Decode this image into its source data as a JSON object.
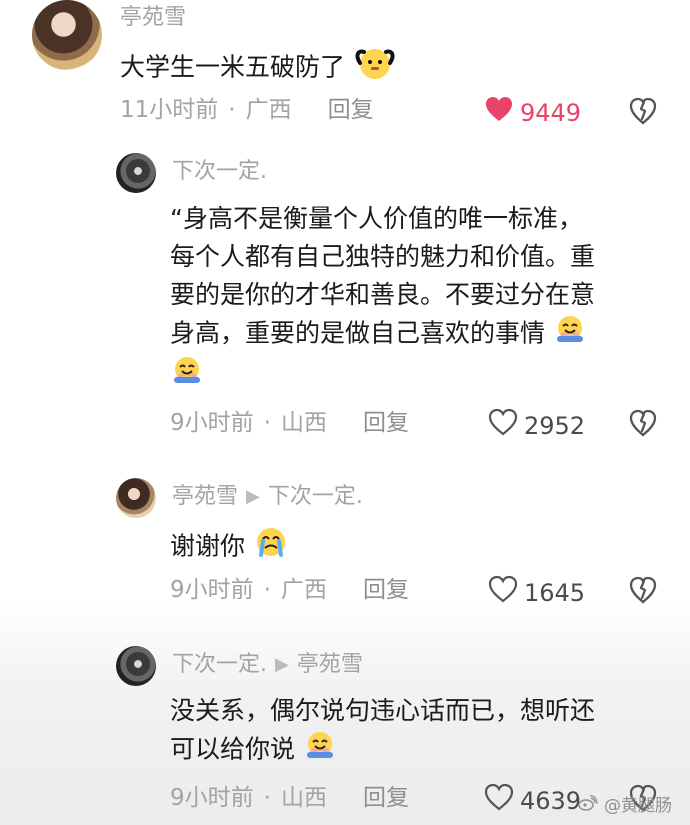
{
  "comments": [
    {
      "username": "亭苑雪",
      "content": "大学生一米五破防了",
      "time": "11小时前",
      "location": "广西",
      "reply_label": "回复",
      "likes": "9449"
    },
    {
      "username": "下次一定.",
      "content_lines": [
        "“身高不是衡量个人价值的唯一标准，",
        "每个人都有自己独特的魅力和价值。重",
        "要的是你的才华和善良。不要过分在意",
        "身高，重要的是做自己喜欢的事情"
      ],
      "time": "9小时前",
      "location": "山西",
      "reply_label": "回复",
      "likes": "2952"
    },
    {
      "username": "亭苑雪",
      "reply_to": "下次一定.",
      "content": "谢谢你",
      "time": "9小时前",
      "location": "广西",
      "reply_label": "回复",
      "likes": "1645"
    },
    {
      "username": "下次一定.",
      "reply_to": "亭苑雪",
      "content_lines": [
        "没关系，偶尔说句违心话而已，想听还",
        "可以给你说"
      ],
      "time": "9小时前",
      "location": "山西",
      "reply_label": "回复",
      "likes": "4639"
    }
  ],
  "meta": {
    "dot": "·",
    "reply_arrow": "▶"
  },
  "watermark": {
    "text": "@黄腿肠",
    "icon": "weibo-icon"
  },
  "colors": {
    "liked": "#e84368",
    "meta": "#a3a3a3",
    "text": "#1b1b1b"
  }
}
